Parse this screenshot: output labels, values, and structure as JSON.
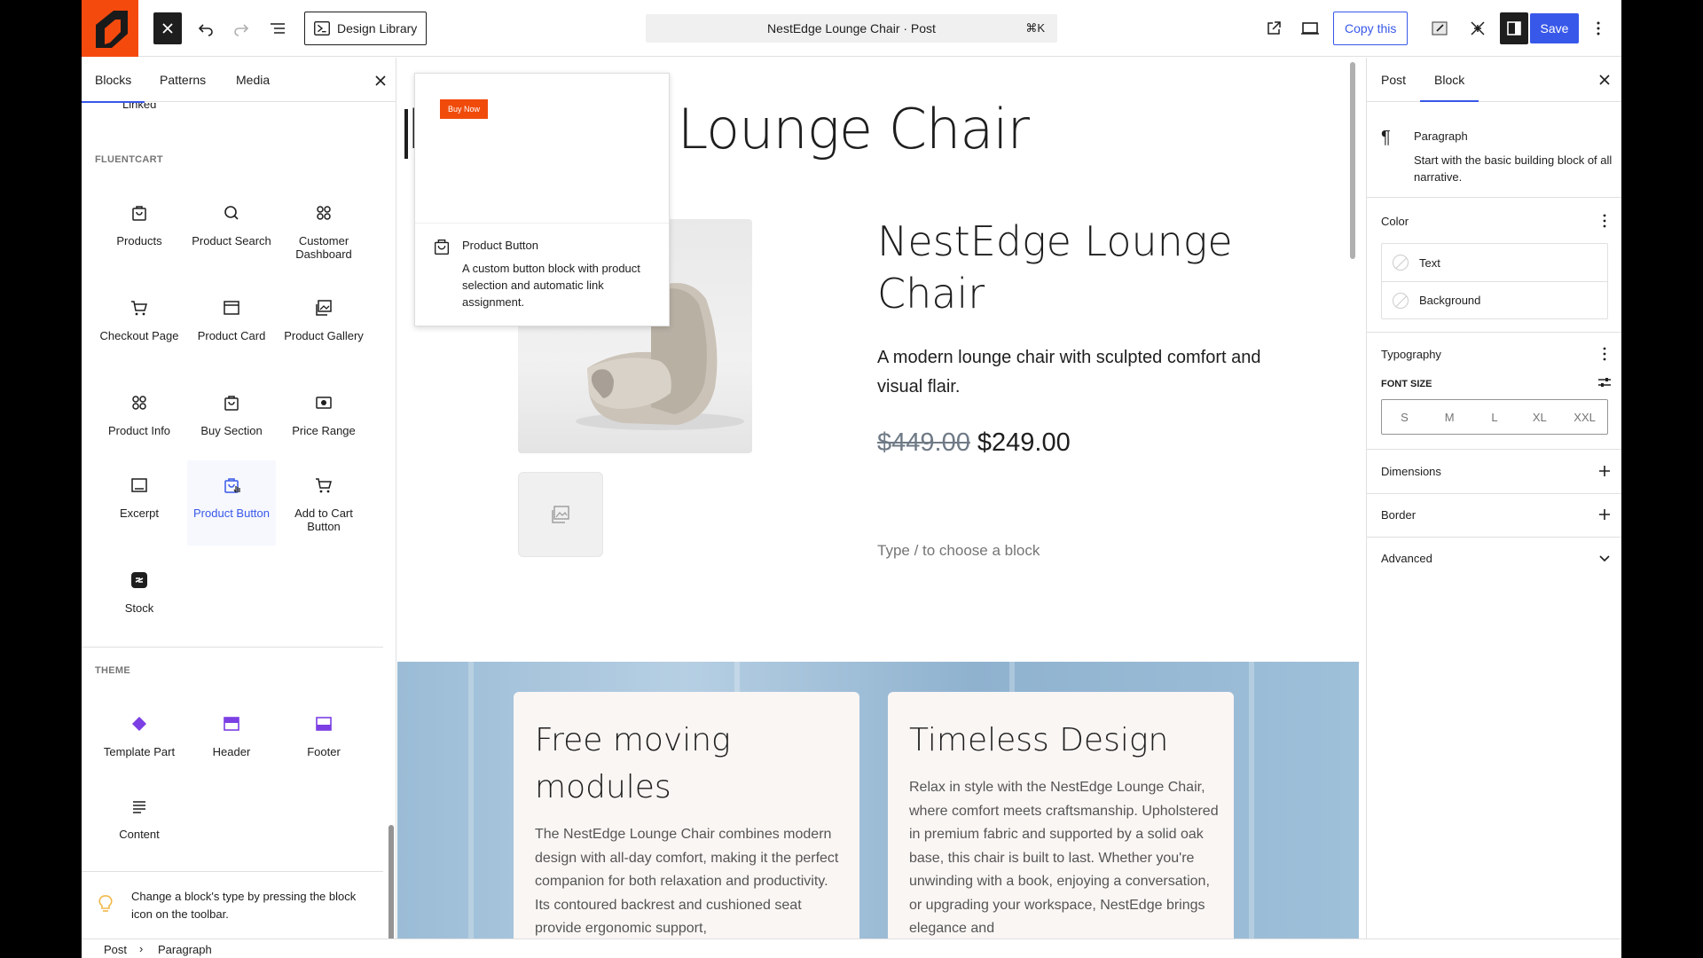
{
  "topbar": {
    "design_library": "Design Library",
    "document_title": "NestEdge Lounge Chair · Post",
    "shortcut": "⌘K",
    "copy_label": "Copy this",
    "save_label": "Save"
  },
  "inserter": {
    "tabs": [
      "Blocks",
      "Patterns",
      "Media"
    ],
    "cut_label": "Linked",
    "categories": {
      "fluentcart": "FLUENTCART",
      "theme": "THEME"
    },
    "fluentcart_blocks": [
      {
        "label": "Products",
        "icon": "bag-icon"
      },
      {
        "label": "Product Search",
        "icon": "search-icon"
      },
      {
        "label": "Customer Dashboard",
        "icon": "grid-icon"
      },
      {
        "label": "Checkout Page",
        "icon": "cart-icon"
      },
      {
        "label": "Product Card",
        "icon": "card-icon"
      },
      {
        "label": "Product Gallery",
        "icon": "gallery-icon"
      },
      {
        "label": "Product Info",
        "icon": "grid-icon"
      },
      {
        "label": "Buy Section",
        "icon": "bag-icon"
      },
      {
        "label": "Price Range",
        "icon": "range-icon"
      },
      {
        "label": "Excerpt",
        "icon": "excerpt-icon"
      },
      {
        "label": "Product Button",
        "icon": "bag-icon"
      },
      {
        "label": "Add to Cart Button",
        "icon": "cart-icon"
      },
      {
        "label": "Stock",
        "icon": "stock-icon"
      }
    ],
    "theme_blocks": [
      {
        "label": "Template Part",
        "icon": "diamond-icon"
      },
      {
        "label": "Header",
        "icon": "header-icon"
      },
      {
        "label": "Footer",
        "icon": "footer-icon"
      },
      {
        "label": "Content",
        "icon": "lines-icon"
      }
    ],
    "tip": "Change a block's type by pressing the block icon on the toolbar."
  },
  "preview": {
    "buy_now": "Buy Now",
    "title": "Product Button",
    "description": "A custom button block with product selection and automatic link assignment."
  },
  "canvas": {
    "page_title": "NestEdge Lounge Chair",
    "product_title": "NestEdge Lounge Chair",
    "product_description": "A modern lounge chair with sculpted comfort and visual flair.",
    "old_price": "$449.00",
    "price": "$249.00",
    "placeholder": "Type / to choose a block",
    "features": [
      {
        "title": "Free moving modules",
        "text": "The NestEdge Lounge Chair combines modern design with all-day comfort, making it the perfect companion for both relaxation and productivity. Its contoured backrest and cushioned seat provide ergonomic support,"
      },
      {
        "title": "Timeless Design",
        "text": "Relax in style with the NestEdge Lounge Chair, where comfort meets craftsmanship. Upholstered in premium fabric and supported by a solid oak base, this chair is built to last. Whether you're unwinding with a book, enjoying a conversation, or upgrading your workspace, NestEdge brings elegance and"
      }
    ]
  },
  "sidebar": {
    "tabs": [
      "Post",
      "Block"
    ],
    "block_name": "Paragraph",
    "block_description": "Start with the basic building block of all narrative.",
    "color_title": "Color",
    "color_options": [
      "Text",
      "Background"
    ],
    "typography_title": "Typography",
    "font_size_label": "FONT SIZE",
    "font_sizes": [
      "S",
      "M",
      "L",
      "XL",
      "XXL"
    ],
    "dimensions": "Dimensions",
    "border": "Border",
    "advanced": "Advanced"
  },
  "breadcrumb": [
    "Post",
    "Paragraph"
  ],
  "colors": {
    "accent": "#3858e9",
    "brand": "#f54a0e",
    "buy_now": "#f04b0b"
  }
}
